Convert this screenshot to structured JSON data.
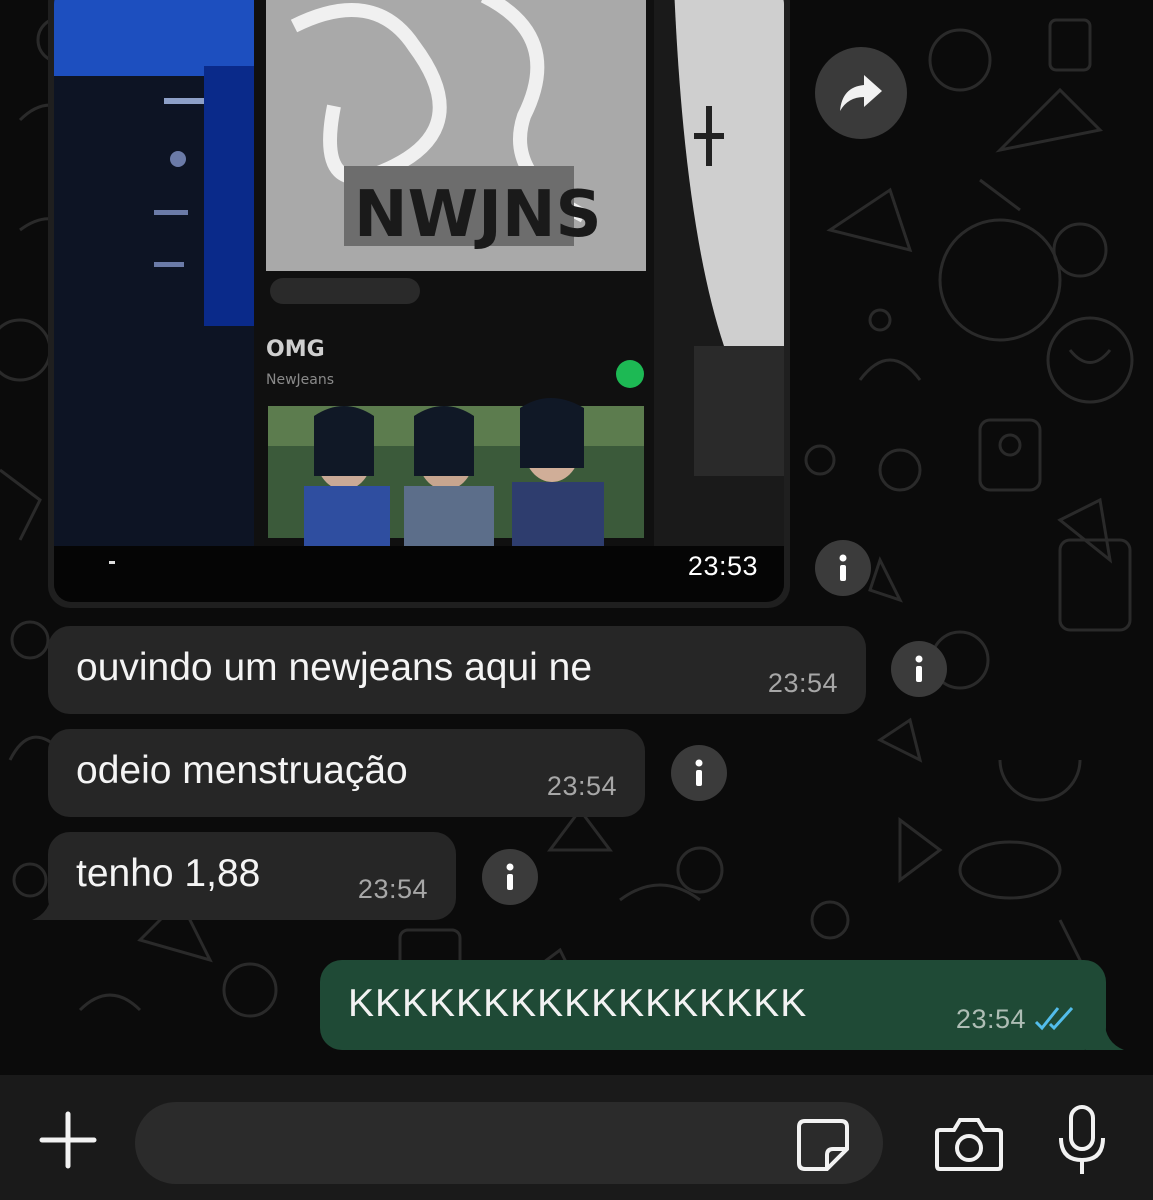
{
  "chat": {
    "image_message": {
      "time": "23:53",
      "screen_title": "OMG",
      "screen_artist": "NewJeans"
    },
    "incoming": [
      {
        "text": "ouvindo um newjeans aqui ne",
        "time": "23:54"
      },
      {
        "text": "odeio menstruação",
        "time": "23:54"
      },
      {
        "text": "tenho 1,88",
        "time": "23:54"
      }
    ],
    "outgoing": [
      {
        "text": "KKKKKKKKKKKKKKKKK",
        "time": "23:54",
        "status": "read"
      }
    ]
  },
  "input_bar": {
    "placeholder": ""
  },
  "icons": {
    "forward": "forward-arrow-icon",
    "info": "info-icon",
    "attach": "plus-icon",
    "sticker": "sticker-icon",
    "camera": "camera-icon",
    "mic": "microphone-icon",
    "read": "double-check-icon"
  },
  "colors": {
    "background": "#0b0b0b",
    "incoming_bubble": "#262626",
    "outgoing_bubble": "#1f4a36",
    "read_ticks": "#53bdeb"
  }
}
